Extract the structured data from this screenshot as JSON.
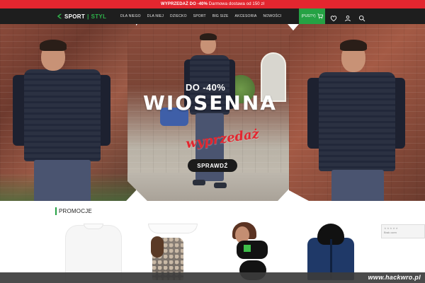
{
  "promo": {
    "highlight": "WYPRZEDAŻ DO -40%",
    "rest": " Darmowa dostawa od 150 zł"
  },
  "header": {
    "logo_left": "SPORT",
    "logo_sep": "|",
    "logo_right": "STYL",
    "nav": [
      "DLA NIEGO",
      "DLA NIEJ",
      "DZIECKO",
      "SPORT",
      "BIG SIZE",
      "AKCESORIA",
      "NOWOŚCI"
    ],
    "cart_label": "(PUSTY)",
    "icons": [
      "wishlist-heart-icon",
      "account-user-icon",
      "search-icon"
    ]
  },
  "hero": {
    "discount": "DO -40%",
    "title": "WIOSENNA",
    "script": "wyprzedaż",
    "button": "SPRAWDŹ"
  },
  "section": {
    "title": "PROMOCJE"
  },
  "rating_widget": {
    "stars": "★★★★★",
    "label": "Brak ocen"
  },
  "watermark": "www.hackwro.pl",
  "colors": {
    "promo_bar": "#e3262f",
    "header_bg": "#1e1e1e",
    "accent_green": "#25a244",
    "hero_red": "#e3262f"
  }
}
